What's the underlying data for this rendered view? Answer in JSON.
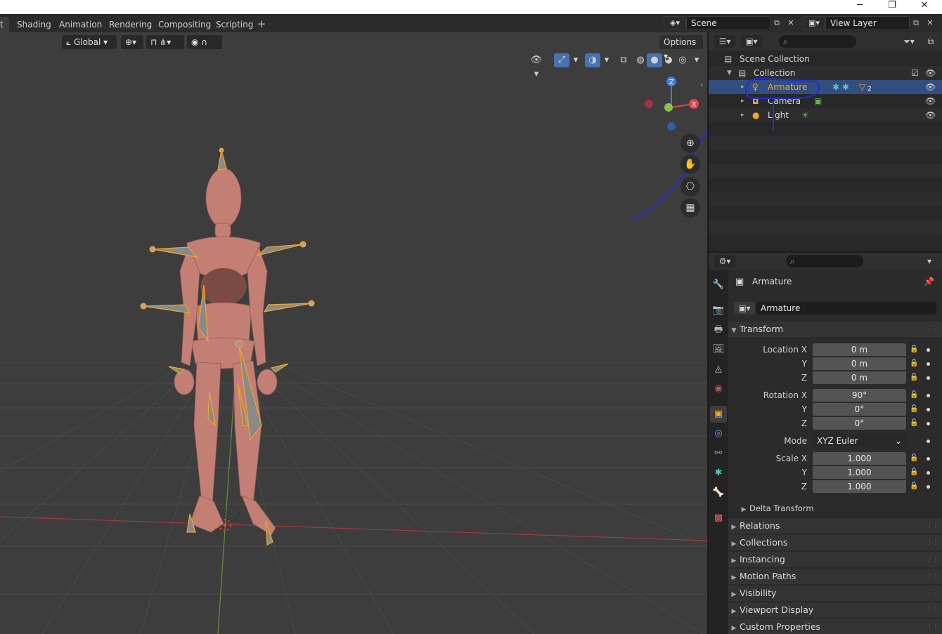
{
  "window_controls": {
    "minimize": "─",
    "restore": "❐",
    "close": "✕"
  },
  "workspace_tabs": [
    {
      "label": "t",
      "active": true
    },
    {
      "label": "Shading"
    },
    {
      "label": "Animation"
    },
    {
      "label": "Rendering"
    },
    {
      "label": "Compositing"
    },
    {
      "label": "Scripting"
    }
  ],
  "add_workspace": "+",
  "scene": {
    "label": "Scene",
    "view_layer": "View Layer"
  },
  "viewport_header": {
    "orientation": "Global",
    "options": "Options"
  },
  "gizmo": {
    "z": "Z",
    "x": "X",
    "y": "Y"
  },
  "outliner": {
    "rows": [
      {
        "label": "Scene Collection"
      },
      {
        "label": "Collection"
      },
      {
        "label": "Armature",
        "badge": "2"
      },
      {
        "label": "Camera"
      },
      {
        "label": "Light"
      }
    ]
  },
  "properties": {
    "object_name": "Armature",
    "name_field": "Armature",
    "transform": {
      "title": "Transform",
      "location": {
        "label_x": "Location X",
        "label_y": "Y",
        "label_z": "Z",
        "x": "0 m",
        "y": "0 m",
        "z": "0 m"
      },
      "rotation": {
        "label_x": "Rotation X",
        "label_y": "Y",
        "label_z": "Z",
        "x": "90°",
        "y": "0°",
        "z": "0°"
      },
      "mode": {
        "label": "Mode",
        "value": "XYZ Euler"
      },
      "scale": {
        "label_x": "Scale X",
        "label_y": "Y",
        "label_z": "Z",
        "x": "1.000",
        "y": "1.000",
        "z": "1.000"
      }
    },
    "delta_transform": "Delta Transform",
    "panels": [
      "Relations",
      "Collections",
      "Instancing",
      "Motion Paths",
      "Visibility",
      "Viewport Display",
      "Custom Properties"
    ]
  },
  "colors": {
    "selection": "#334d80",
    "armature_orange": "#f5a623",
    "axis_x": "#e8404f",
    "axis_y": "#8bc34a",
    "axis_z": "#3d7fd6",
    "annotation": "#1f2fd0"
  }
}
